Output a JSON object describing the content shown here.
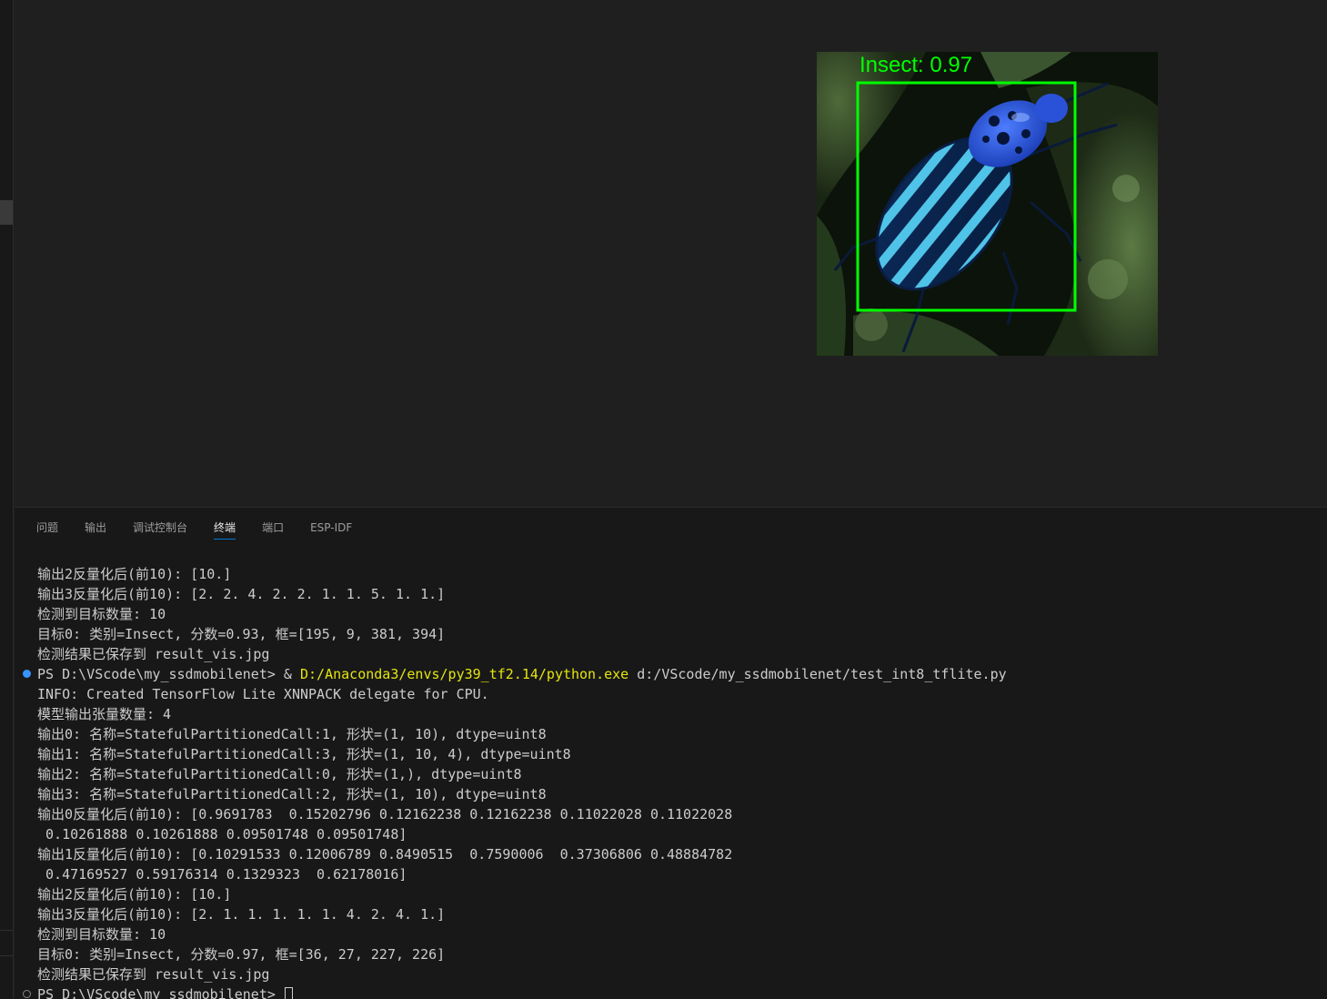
{
  "image": {
    "detection_label": "Insect: 0.97",
    "box_color": "#00ff00"
  },
  "panel": {
    "tabs": [
      {
        "label": "问题"
      },
      {
        "label": "输出"
      },
      {
        "label": "调试控制台"
      },
      {
        "label": "终端",
        "active": true
      },
      {
        "label": "端口"
      },
      {
        "label": "ESP-IDF"
      }
    ]
  },
  "terminal": {
    "lines": [
      {
        "text": "输出2反量化后(前10): [10.]"
      },
      {
        "text": "输出3反量化后(前10): [2. 2. 4. 2. 2. 1. 1. 5. 1. 1.]"
      },
      {
        "text": "检测到目标数量: 10"
      },
      {
        "text": "目标0: 类别=Insect, 分数=0.93, 框=[195, 9, 381, 394]"
      },
      {
        "text": "检测结果已保存到 result_vis.jpg"
      },
      {
        "prompt": "PS D:\\VScode\\my_ssdmobilenet> & ",
        "exe": "D:/Anaconda3/envs/py39_tf2.14/python.exe",
        "args": " d:/VScode/my_ssdmobilenet/test_int8_tflite.py",
        "marker": "blue"
      },
      {
        "text": "INFO: Created TensorFlow Lite XNNPACK delegate for CPU."
      },
      {
        "text": "模型输出张量数量: 4"
      },
      {
        "text": "输出0: 名称=StatefulPartitionedCall:1, 形状=(1, 10), dtype=uint8"
      },
      {
        "text": "输出1: 名称=StatefulPartitionedCall:3, 形状=(1, 10, 4), dtype=uint8"
      },
      {
        "text": "输出2: 名称=StatefulPartitionedCall:0, 形状=(1,), dtype=uint8"
      },
      {
        "text": "输出3: 名称=StatefulPartitionedCall:2, 形状=(1, 10), dtype=uint8"
      },
      {
        "text": "输出0反量化后(前10): [0.9691783  0.15202796 0.12162238 0.12162238 0.11022028 0.11022028"
      },
      {
        "text": " 0.10261888 0.10261888 0.09501748 0.09501748]"
      },
      {
        "text": "输出1反量化后(前10): [0.10291533 0.12006789 0.8490515  0.7590006  0.37306806 0.48884782"
      },
      {
        "text": " 0.47169527 0.59176314 0.1329323  0.62178016]"
      },
      {
        "text": "输出2反量化后(前10): [10.]"
      },
      {
        "text": "输出3反量化后(前10): [2. 1. 1. 1. 1. 1. 4. 2. 4. 1.]"
      },
      {
        "text": "检测到目标数量: 10"
      },
      {
        "text": "目标0: 类别=Insect, 分数=0.97, 框=[36, 27, 227, 226]"
      },
      {
        "text": "检测结果已保存到 result_vis.jpg"
      },
      {
        "prompt": "PS D:\\VScode\\my_ssdmobilenet> ",
        "cursor": true,
        "marker": "hollow"
      }
    ]
  }
}
